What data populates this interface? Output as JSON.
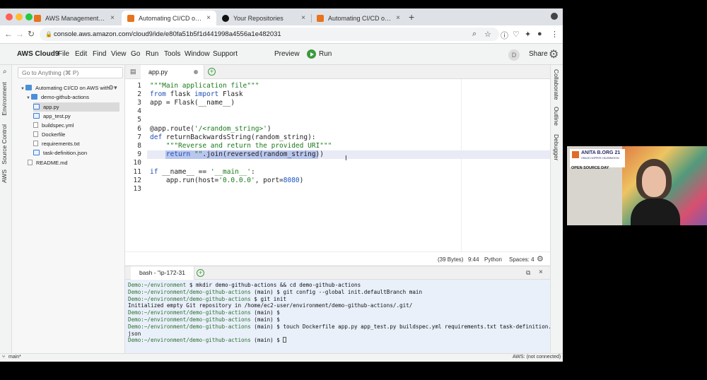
{
  "browser": {
    "tabs": [
      {
        "label": "AWS Management Console",
        "icon": "aws-icon",
        "active": false
      },
      {
        "label": "Automating CI/CD on AWS wit",
        "icon": "aws-icon",
        "active": true
      },
      {
        "label": "Your Repositories",
        "icon": "github-icon",
        "active": false
      },
      {
        "label": "Automating CI/CD on AWS wit",
        "icon": "aws-icon",
        "active": false
      }
    ],
    "new_tab": "+",
    "close_glyph": "×",
    "url": "console.aws.amazon.com/cloud9/ide/e80fa51b5f1d441998a4556a1e482031"
  },
  "menubar": {
    "brand": "AWS Cloud9",
    "items": [
      "File",
      "Edit",
      "Find",
      "View",
      "Go",
      "Run",
      "Tools",
      "Window",
      "Support"
    ],
    "preview": "Preview",
    "run": "Run",
    "avatar": "D",
    "share": "Share"
  },
  "left_strip": [
    "Environment",
    "Source Control",
    "AWS"
  ],
  "right_strip": [
    "Collaborate",
    "Outline",
    "Debugger"
  ],
  "tree": {
    "search_placeholder": "Go to Anything (⌘ P)",
    "root": "Automating CI/CD on AWS with",
    "folder": "demo-github-actions",
    "files": [
      "app.py",
      "app_test.py",
      "buildspec.yml",
      "Dockerfile",
      "requirements.txt",
      "task-definition.json"
    ],
    "root_file": "README.md"
  },
  "editor": {
    "tab": "app.py",
    "line_numbers": [
      "1",
      "2",
      "3",
      "4",
      "5",
      "6",
      "7",
      "8",
      "9",
      "10",
      "11",
      "12",
      "13"
    ],
    "status": {
      "size": "(39 Bytes)",
      "position": "9:44",
      "language": "Python",
      "spaces": "Spaces: 4"
    }
  },
  "terminal": {
    "tab": "bash - \"ip-172-31",
    "prompt": "Demo:~/environment $",
    "lines": [
      {
        "prompt": "Demo:~/environment",
        "text": " $ mkdir demo-github-actions && cd demo-github-actions"
      },
      {
        "prompt": "Demo:~/environment/demo-github-actions",
        "text": " (main) $ git config --global init.defaultBranch main"
      },
      {
        "prompt": "Demo:~/environment/demo-github-actions",
        "text": " $ git init"
      },
      {
        "prompt": "",
        "text": "Initialized empty Git repository in /home/ec2-user/environment/demo-github-actions/.git/"
      },
      {
        "prompt": "Demo:~/environment/demo-github-actions",
        "text": " (main) $"
      },
      {
        "prompt": "Demo:~/environment/demo-github-actions",
        "text": " (main) $"
      },
      {
        "prompt": "Demo:~/environment/demo-github-actions",
        "text": " (main) $ touch Dockerfile app.py app_test.py buildspec.yml requirements.txt task-definition."
      },
      {
        "prompt": "",
        "text": "json"
      },
      {
        "prompt": "Demo:~/environment/demo-github-actions",
        "text": " (main) $ "
      }
    ]
  },
  "bottom_bar": {
    "branch": "main*",
    "aws_status": "AWS: (not connected)"
  },
  "webcam": {
    "logo_line1": "ANITA B.ORG 21",
    "logo_line2": "GRACE HOPPER CELEBRATION",
    "caption": "OPEN SOURCE DAY"
  }
}
